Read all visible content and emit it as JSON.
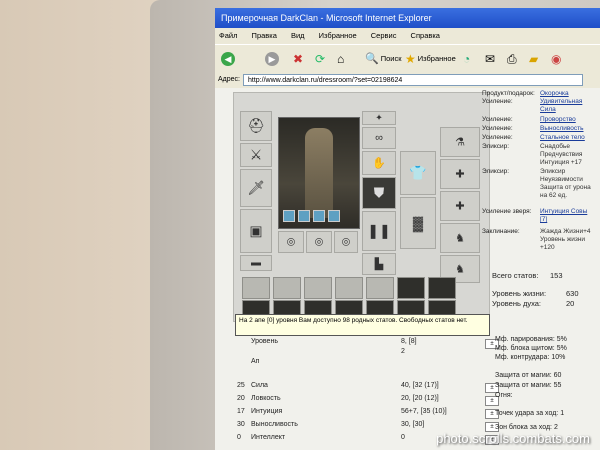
{
  "window": {
    "title": "Примерочная DarkClan - Microsoft Internet Explorer"
  },
  "menu": {
    "items": [
      "Файл",
      "Правка",
      "Вид",
      "Избранное",
      "Сервис",
      "Справка"
    ]
  },
  "toolbar": {
    "search_label": "Поиск",
    "favorites_label": "Избранное"
  },
  "address": {
    "label": "Адрес:",
    "url": "http://www.darkclan.ru/dressroom/?set=02198624"
  },
  "tooltip": {
    "text": "На 2 апе [0] уровня Вам доступно 98 родных статов. Свободных статов нет."
  },
  "item_properties": [
    {
      "label": "Продукт/подарок:",
      "value": "Окорочка",
      "link": true
    },
    {
      "label": "Усиление:",
      "value": "Удивительная Сила",
      "link": true
    },
    {
      "label": "Усиление:",
      "value": "Проворство",
      "link": true
    },
    {
      "label": "Усиление:",
      "value": "Выносливость",
      "link": true
    },
    {
      "label": "Усиление:",
      "value": "Стальное тело",
      "link": true
    },
    {
      "label": "Эликсир:",
      "value": "Снадобье Предчувствия Интуиция +17",
      "link": false
    },
    {
      "label": "Эликсир:",
      "value": "Эликсир Неуязвимости Защита от урона на 62 ед.",
      "link": false
    },
    {
      "label": "Усиление зверя:",
      "value": "Интуиция Совы [7]",
      "link": true
    },
    {
      "label": "Заклинание:",
      "value": "Жажда Жизни+4 Уровень жизни +120",
      "link": false
    }
  ],
  "summary": {
    "total_stats_label": "Всего статов:",
    "total_stats_value": "153",
    "hp_label": "Уровень жизни:",
    "hp_value": "630",
    "spirit_label": "Уровень духа:",
    "spirit_value": "20"
  },
  "stats": {
    "level_label": "Уровень",
    "level_value": "8, [8]",
    "level_sub": "2",
    "up_label": "Ап",
    "rows": [
      {
        "index": "25",
        "label": "Сила",
        "value": "40, [32 (17)]"
      },
      {
        "index": "20",
        "label": "Ловкость",
        "value": "20, [20 (12)]"
      },
      {
        "index": "17",
        "label": "Интуиция",
        "value": "56+7, [35 (10)]"
      },
      {
        "index": "30",
        "label": "Выносливость",
        "value": "30, [30]"
      },
      {
        "index": "0",
        "label": "Интеллект",
        "value": "0"
      }
    ],
    "right": [
      {
        "label": "Мф. парирования:",
        "value": "5%"
      },
      {
        "label": "Мф. блока щитом:",
        "value": "5%"
      },
      {
        "label": "Мф. контрудара:",
        "value": "10%"
      },
      {
        "label": "Защита от магии:",
        "value": "60"
      },
      {
        "label": "Защита от магии:",
        "value": "55"
      },
      {
        "label": "Огня:",
        "value": ""
      },
      {
        "label": "Точек удара за ход:",
        "value": "1"
      },
      {
        "label": "Зон блока за ход:",
        "value": "2"
      }
    ]
  },
  "watermark": "photo.scrolls.combats.com",
  "colors": {
    "title_bar": "#1f4fc8",
    "link": "#1a3c9a",
    "tooltip_bg": "#ffffe1"
  }
}
